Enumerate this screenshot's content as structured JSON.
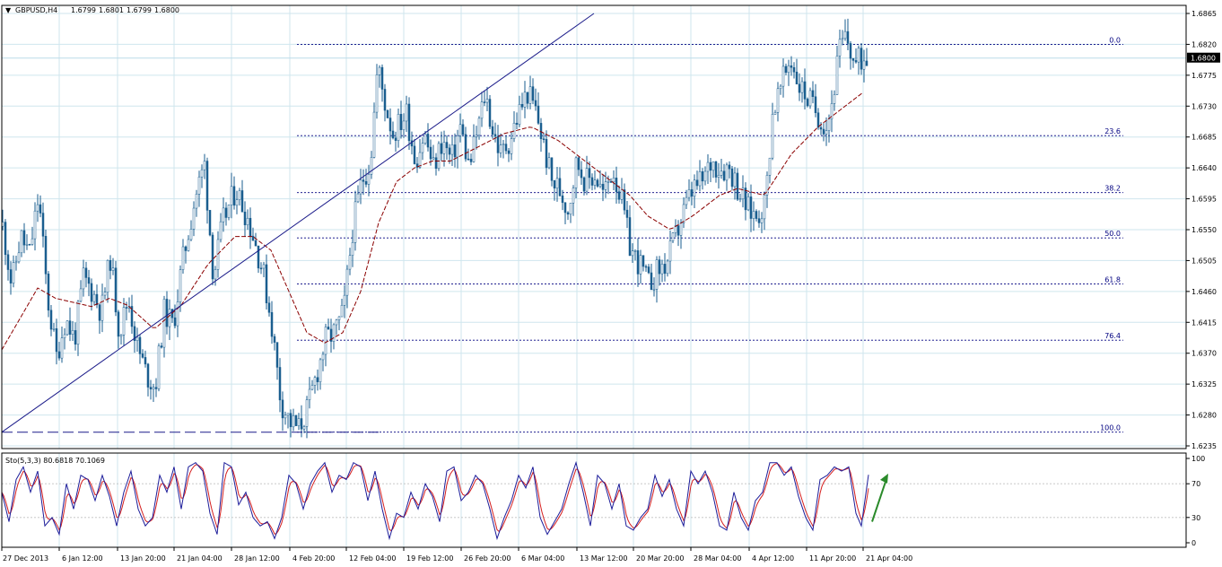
{
  "chart_data": [
    {
      "type": "candlestick",
      "header": {
        "symbol_timeframe": "GBPUSD,H4",
        "ohlc": [
          "1.6799",
          "1.6801",
          "1.6799",
          "1.6800"
        ]
      },
      "current_price_label": "1.6800",
      "y_ticks": [
        "1.6865",
        "1.6820",
        "1.6775",
        "1.6730",
        "1.6685",
        "1.6640",
        "1.6595",
        "1.6550",
        "1.6505",
        "1.6460",
        "1.6415",
        "1.6370",
        "1.6325",
        "1.6280",
        "1.6235"
      ],
      "ylim": [
        1.6235,
        1.6865
      ],
      "x_ticks": [
        "27 Dec 2013",
        "6 Jan 12:00",
        "13 Jan 20:00",
        "21 Jan 04:00",
        "28 Jan 12:00",
        "4 Feb 20:00",
        "12 Feb 04:00",
        "19 Feb 12:00",
        "26 Feb 20:00",
        "6 Mar 04:00",
        "13 Mar 12:00",
        "20 Mar 20:00",
        "28 Mar 04:00",
        "4 Apr 12:00",
        "11 Apr 20:00",
        "21 Apr 04:00"
      ],
      "anchors": [
        {
          "x": 0,
          "v": 1.6555
        },
        {
          "x": 10,
          "v": 1.647
        },
        {
          "x": 20,
          "v": 1.654
        },
        {
          "x": 30,
          "v": 1.6515
        },
        {
          "x": 40,
          "v": 1.66
        },
        {
          "x": 50,
          "v": 1.645
        },
        {
          "x": 60,
          "v": 1.6365
        },
        {
          "x": 70,
          "v": 1.642
        },
        {
          "x": 80,
          "v": 1.639
        },
        {
          "x": 90,
          "v": 1.648
        },
        {
          "x": 100,
          "v": 1.646
        },
        {
          "x": 110,
          "v": 1.643
        },
        {
          "x": 120,
          "v": 1.651
        },
        {
          "x": 130,
          "v": 1.64
        },
        {
          "x": 140,
          "v": 1.645
        },
        {
          "x": 150,
          "v": 1.638
        },
        {
          "x": 160,
          "v": 1.634
        },
        {
          "x": 170,
          "v": 1.632
        },
        {
          "x": 180,
          "v": 1.643
        },
        {
          "x": 190,
          "v": 1.641
        },
        {
          "x": 200,
          "v": 1.65
        },
        {
          "x": 215,
          "v": 1.66
        },
        {
          "x": 225,
          "v": 1.6645
        },
        {
          "x": 235,
          "v": 1.648
        },
        {
          "x": 245,
          "v": 1.656
        },
        {
          "x": 260,
          "v": 1.661
        },
        {
          "x": 275,
          "v": 1.656
        },
        {
          "x": 290,
          "v": 1.649
        },
        {
          "x": 300,
          "v": 1.641
        },
        {
          "x": 310,
          "v": 1.63
        },
        {
          "x": 320,
          "v": 1.627
        },
        {
          "x": 330,
          "v": 1.626
        },
        {
          "x": 340,
          "v": 1.629
        },
        {
          "x": 350,
          "v": 1.634
        },
        {
          "x": 360,
          "v": 1.639
        },
        {
          "x": 370,
          "v": 1.64
        },
        {
          "x": 380,
          "v": 1.643
        },
        {
          "x": 390,
          "v": 1.655
        },
        {
          "x": 400,
          "v": 1.662
        },
        {
          "x": 410,
          "v": 1.665
        },
        {
          "x": 418,
          "v": 1.679
        },
        {
          "x": 425,
          "v": 1.674
        },
        {
          "x": 435,
          "v": 1.669
        },
        {
          "x": 450,
          "v": 1.672
        },
        {
          "x": 460,
          "v": 1.665
        },
        {
          "x": 470,
          "v": 1.669
        },
        {
          "x": 480,
          "v": 1.664
        },
        {
          "x": 490,
          "v": 1.668
        },
        {
          "x": 500,
          "v": 1.665
        },
        {
          "x": 510,
          "v": 1.67
        },
        {
          "x": 520,
          "v": 1.664
        },
        {
          "x": 530,
          "v": 1.67
        },
        {
          "x": 538,
          "v": 1.675
        },
        {
          "x": 545,
          "v": 1.67
        },
        {
          "x": 555,
          "v": 1.666
        },
        {
          "x": 565,
          "v": 1.668
        },
        {
          "x": 575,
          "v": 1.672
        },
        {
          "x": 585,
          "v": 1.675
        },
        {
          "x": 595,
          "v": 1.672
        },
        {
          "x": 605,
          "v": 1.666
        },
        {
          "x": 612,
          "v": 1.662
        },
        {
          "x": 620,
          "v": 1.661
        },
        {
          "x": 630,
          "v": 1.658
        },
        {
          "x": 640,
          "v": 1.665
        },
        {
          "x": 650,
          "v": 1.662
        },
        {
          "x": 660,
          "v": 1.663
        },
        {
          "x": 670,
          "v": 1.66
        },
        {
          "x": 680,
          "v": 1.664
        },
        {
          "x": 690,
          "v": 1.659
        },
        {
          "x": 700,
          "v": 1.652
        },
        {
          "x": 710,
          "v": 1.65
        },
        {
          "x": 720,
          "v": 1.647
        },
        {
          "x": 730,
          "v": 1.649
        },
        {
          "x": 740,
          "v": 1.65
        },
        {
          "x": 750,
          "v": 1.654
        },
        {
          "x": 760,
          "v": 1.658
        },
        {
          "x": 770,
          "v": 1.661
        },
        {
          "x": 780,
          "v": 1.662
        },
        {
          "x": 790,
          "v": 1.665
        },
        {
          "x": 800,
          "v": 1.664
        },
        {
          "x": 810,
          "v": 1.664
        },
        {
          "x": 820,
          "v": 1.661
        },
        {
          "x": 830,
          "v": 1.658
        },
        {
          "x": 840,
          "v": 1.657
        },
        {
          "x": 850,
          "v": 1.659
        },
        {
          "x": 858,
          "v": 1.672
        },
        {
          "x": 868,
          "v": 1.676
        },
        {
          "x": 878,
          "v": 1.68
        },
        {
          "x": 888,
          "v": 1.676
        },
        {
          "x": 898,
          "v": 1.674
        },
        {
          "x": 908,
          "v": 1.672
        },
        {
          "x": 918,
          "v": 1.67
        },
        {
          "x": 925,
          "v": 1.674
        },
        {
          "x": 932,
          "v": 1.681
        },
        {
          "x": 940,
          "v": 1.683
        },
        {
          "x": 950,
          "v": 1.679
        },
        {
          "x": 958,
          "v": 1.68
        },
        {
          "x": 965,
          "v": 1.68
        }
      ],
      "moving_average": [
        {
          "x": 0,
          "v": 1.6375
        },
        {
          "x": 40,
          "v": 1.6465
        },
        {
          "x": 60,
          "v": 1.645
        },
        {
          "x": 100,
          "v": 1.6438
        },
        {
          "x": 120,
          "v": 1.645
        },
        {
          "x": 140,
          "v": 1.644
        },
        {
          "x": 170,
          "v": 1.6405
        },
        {
          "x": 200,
          "v": 1.644
        },
        {
          "x": 230,
          "v": 1.65
        },
        {
          "x": 260,
          "v": 1.654
        },
        {
          "x": 280,
          "v": 1.654
        },
        {
          "x": 300,
          "v": 1.652
        },
        {
          "x": 320,
          "v": 1.646
        },
        {
          "x": 340,
          "v": 1.64
        },
        {
          "x": 360,
          "v": 1.6385
        },
        {
          "x": 380,
          "v": 1.64
        },
        {
          "x": 400,
          "v": 1.646
        },
        {
          "x": 420,
          "v": 1.656
        },
        {
          "x": 440,
          "v": 1.662
        },
        {
          "x": 460,
          "v": 1.664
        },
        {
          "x": 480,
          "v": 1.665
        },
        {
          "x": 500,
          "v": 1.665
        },
        {
          "x": 530,
          "v": 1.667
        },
        {
          "x": 560,
          "v": 1.669
        },
        {
          "x": 590,
          "v": 1.67
        },
        {
          "x": 620,
          "v": 1.668
        },
        {
          "x": 650,
          "v": 1.665
        },
        {
          "x": 680,
          "v": 1.662
        },
        {
          "x": 700,
          "v": 1.66
        },
        {
          "x": 720,
          "v": 1.657
        },
        {
          "x": 745,
          "v": 1.655
        },
        {
          "x": 770,
          "v": 1.657
        },
        {
          "x": 800,
          "v": 1.66
        },
        {
          "x": 820,
          "v": 1.661
        },
        {
          "x": 850,
          "v": 1.66
        },
        {
          "x": 880,
          "v": 1.666
        },
        {
          "x": 910,
          "v": 1.67
        },
        {
          "x": 940,
          "v": 1.673
        },
        {
          "x": 960,
          "v": 1.675
        }
      ],
      "trendline": {
        "from": {
          "x": 0,
          "v": 1.6255
        },
        "to": {
          "x": 660,
          "v": 1.6865
        }
      },
      "support_line": {
        "v": 1.6255,
        "from_x": 0,
        "to_x": 425
      },
      "fibonacci": {
        "high": 1.682,
        "low": 1.6255,
        "levels": [
          {
            "label": "0.0",
            "v": 1.682
          },
          {
            "label": "23.6",
            "v": 1.6687
          },
          {
            "label": "38.2",
            "v": 1.6604
          },
          {
            "label": "50.0",
            "v": 1.6538
          },
          {
            "label": "61.8",
            "v": 1.6471
          },
          {
            "label": "76.4",
            "v": 1.6389
          },
          {
            "label": "100.0",
            "v": 1.6255
          }
        ]
      },
      "current_price": 1.68,
      "colors": {
        "candle": "#1a5e8f",
        "ma": "#8b0000",
        "fib": "#000080",
        "trendline": "#1c1c8a",
        "grid": "#cfe6ee",
        "price_line": "#bcdbe8"
      }
    },
    {
      "type": "line",
      "title": "Sto(5,3,3) 80.6818 70.1069",
      "y_ticks": [
        "100",
        "70",
        "30",
        "0"
      ],
      "ylim": [
        0,
        100
      ],
      "levels": [
        70,
        30
      ],
      "main_anchors": [
        {
          "x": 0,
          "v": 60
        },
        {
          "x": 8,
          "v": 25
        },
        {
          "x": 16,
          "v": 75
        },
        {
          "x": 24,
          "v": 90
        },
        {
          "x": 32,
          "v": 60
        },
        {
          "x": 40,
          "v": 85
        },
        {
          "x": 48,
          "v": 20
        },
        {
          "x": 56,
          "v": 30
        },
        {
          "x": 64,
          "v": 10
        },
        {
          "x": 72,
          "v": 70
        },
        {
          "x": 80,
          "v": 40
        },
        {
          "x": 88,
          "v": 80
        },
        {
          "x": 96,
          "v": 75
        },
        {
          "x": 104,
          "v": 50
        },
        {
          "x": 112,
          "v": 80
        },
        {
          "x": 120,
          "v": 55
        },
        {
          "x": 128,
          "v": 20
        },
        {
          "x": 136,
          "v": 60
        },
        {
          "x": 144,
          "v": 85
        },
        {
          "x": 152,
          "v": 40
        },
        {
          "x": 160,
          "v": 20
        },
        {
          "x": 168,
          "v": 30
        },
        {
          "x": 176,
          "v": 80
        },
        {
          "x": 184,
          "v": 60
        },
        {
          "x": 192,
          "v": 90
        },
        {
          "x": 200,
          "v": 40
        },
        {
          "x": 208,
          "v": 90
        },
        {
          "x": 216,
          "v": 95
        },
        {
          "x": 224,
          "v": 85
        },
        {
          "x": 232,
          "v": 35
        },
        {
          "x": 240,
          "v": 10
        },
        {
          "x": 248,
          "v": 95
        },
        {
          "x": 256,
          "v": 90
        },
        {
          "x": 264,
          "v": 45
        },
        {
          "x": 272,
          "v": 60
        },
        {
          "x": 280,
          "v": 30
        },
        {
          "x": 288,
          "v": 20
        },
        {
          "x": 296,
          "v": 25
        },
        {
          "x": 304,
          "v": 5
        },
        {
          "x": 312,
          "v": 30
        },
        {
          "x": 320,
          "v": 80
        },
        {
          "x": 328,
          "v": 70
        },
        {
          "x": 336,
          "v": 40
        },
        {
          "x": 344,
          "v": 70
        },
        {
          "x": 352,
          "v": 85
        },
        {
          "x": 360,
          "v": 95
        },
        {
          "x": 368,
          "v": 60
        },
        {
          "x": 376,
          "v": 80
        },
        {
          "x": 384,
          "v": 75
        },
        {
          "x": 392,
          "v": 95
        },
        {
          "x": 400,
          "v": 90
        },
        {
          "x": 408,
          "v": 50
        },
        {
          "x": 416,
          "v": 85
        },
        {
          "x": 424,
          "v": 40
        },
        {
          "x": 432,
          "v": 5
        },
        {
          "x": 440,
          "v": 35
        },
        {
          "x": 448,
          "v": 30
        },
        {
          "x": 456,
          "v": 60
        },
        {
          "x": 464,
          "v": 40
        },
        {
          "x": 472,
          "v": 70
        },
        {
          "x": 480,
          "v": 55
        },
        {
          "x": 488,
          "v": 25
        },
        {
          "x": 496,
          "v": 85
        },
        {
          "x": 504,
          "v": 90
        },
        {
          "x": 512,
          "v": 50
        },
        {
          "x": 520,
          "v": 60
        },
        {
          "x": 528,
          "v": 80
        },
        {
          "x": 536,
          "v": 70
        },
        {
          "x": 544,
          "v": 40
        },
        {
          "x": 552,
          "v": 5
        },
        {
          "x": 560,
          "v": 30
        },
        {
          "x": 568,
          "v": 50
        },
        {
          "x": 576,
          "v": 80
        },
        {
          "x": 584,
          "v": 65
        },
        {
          "x": 592,
          "v": 90
        },
        {
          "x": 600,
          "v": 30
        },
        {
          "x": 608,
          "v": 10
        },
        {
          "x": 616,
          "v": 25
        },
        {
          "x": 624,
          "v": 40
        },
        {
          "x": 632,
          "v": 70
        },
        {
          "x": 640,
          "v": 95
        },
        {
          "x": 648,
          "v": 60
        },
        {
          "x": 656,
          "v": 20
        },
        {
          "x": 664,
          "v": 80
        },
        {
          "x": 672,
          "v": 70
        },
        {
          "x": 680,
          "v": 40
        },
        {
          "x": 688,
          "v": 70
        },
        {
          "x": 696,
          "v": 20
        },
        {
          "x": 704,
          "v": 15
        },
        {
          "x": 712,
          "v": 30
        },
        {
          "x": 720,
          "v": 40
        },
        {
          "x": 728,
          "v": 80
        },
        {
          "x": 736,
          "v": 55
        },
        {
          "x": 744,
          "v": 75
        },
        {
          "x": 752,
          "v": 40
        },
        {
          "x": 760,
          "v": 20
        },
        {
          "x": 768,
          "v": 85
        },
        {
          "x": 776,
          "v": 70
        },
        {
          "x": 784,
          "v": 85
        },
        {
          "x": 792,
          "v": 60
        },
        {
          "x": 800,
          "v": 20
        },
        {
          "x": 808,
          "v": 15
        },
        {
          "x": 816,
          "v": 60
        },
        {
          "x": 824,
          "v": 30
        },
        {
          "x": 832,
          "v": 15
        },
        {
          "x": 840,
          "v": 50
        },
        {
          "x": 848,
          "v": 60
        },
        {
          "x": 856,
          "v": 95
        },
        {
          "x": 864,
          "v": 95
        },
        {
          "x": 872,
          "v": 80
        },
        {
          "x": 880,
          "v": 90
        },
        {
          "x": 888,
          "v": 55
        },
        {
          "x": 896,
          "v": 30
        },
        {
          "x": 904,
          "v": 15
        },
        {
          "x": 912,
          "v": 75
        },
        {
          "x": 920,
          "v": 80
        },
        {
          "x": 928,
          "v": 90
        },
        {
          "x": 936,
          "v": 85
        },
        {
          "x": 944,
          "v": 90
        },
        {
          "x": 952,
          "v": 35
        },
        {
          "x": 958,
          "v": 20
        },
        {
          "x": 966,
          "v": 80.6818
        }
      ],
      "main_value": 80.6818,
      "signal_value": 70.1069,
      "arrow": {
        "from": {
          "x": 970,
          "v": 25
        },
        "to": {
          "x": 988,
          "v": 82
        },
        "color": "#2a8a2a"
      },
      "colors": {
        "main": "#1d1d9a",
        "signal": "#d41e1e"
      }
    }
  ]
}
